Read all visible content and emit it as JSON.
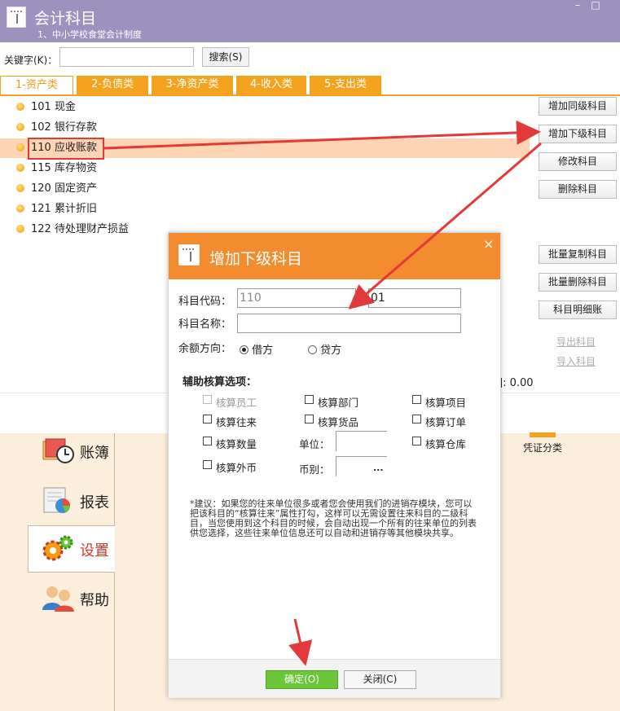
{
  "window": {
    "title": "会计科目",
    "subtitle": "1、中小学校食堂会计制度",
    "controls": [
      "–",
      "□"
    ]
  },
  "search": {
    "label": "关键字(K)：",
    "value": "",
    "button": "搜索(S)"
  },
  "tabs": [
    "1-资产类",
    "2-负债类",
    "3-净资产类",
    "4-收入类",
    "5-支出类"
  ],
  "accounts": [
    "101 现金",
    "102 银行存款",
    "110 应收账款",
    "115 库存物资",
    "120 固定资产",
    "121 累计折旧",
    "122 待处理财产损益"
  ],
  "right_buttons": [
    "增加同级科目",
    "增加下级科目",
    "修改科目",
    "删除科目",
    "批量复制科目",
    "批量删除科目",
    "科目明细账"
  ],
  "right_links": [
    "导出科目",
    "导入科目"
  ],
  "partial_text": "]: 0.00",
  "nav": [
    "账簿",
    "报表",
    "设置",
    "帮助"
  ],
  "voucher_label": "凭证分类",
  "dialog": {
    "title": "增加下级科目",
    "close": "×",
    "code_label": "科目代码：",
    "code_parent": "110",
    "code_child": "01",
    "name_label": "科目名称：",
    "name_value": "",
    "balance_label": "余额方向：",
    "debit": "借方",
    "credit": "贷方",
    "aux_title": "辅助核算选项：",
    "options": {
      "employee": "核算员工",
      "department": "核算部门",
      "project": "核算项目",
      "contact": "核算往来",
      "goods": "核算货品",
      "order": "核算订单",
      "quantity": "核算数量",
      "unit": "单位：",
      "warehouse": "核算仓库",
      "foreign": "核算外币",
      "currency": "币别：",
      "browse": "..."
    },
    "note": "*建议：如果您的往来单位很多或者您会使用我们的进销存模块，您可以把该科目的“核算往来”属性打勾，这样可以无需设置往来科目的二级科目，当您使用到这个科目的时候，会自动出现一个所有的往来单位的列表供您选择，这些往来单位信息还可以自动和进销存等其他模块共享。",
    "ok": "确定(O)",
    "cancel": "关闭(C)"
  },
  "colors": {
    "titlebar": "#9d92bd",
    "tab": "#f5a21e",
    "dialog_header": "#f28c2e",
    "selection": "#fdd4b4",
    "ok_button": "#6cc63a",
    "annotation": "#e23a3a"
  }
}
